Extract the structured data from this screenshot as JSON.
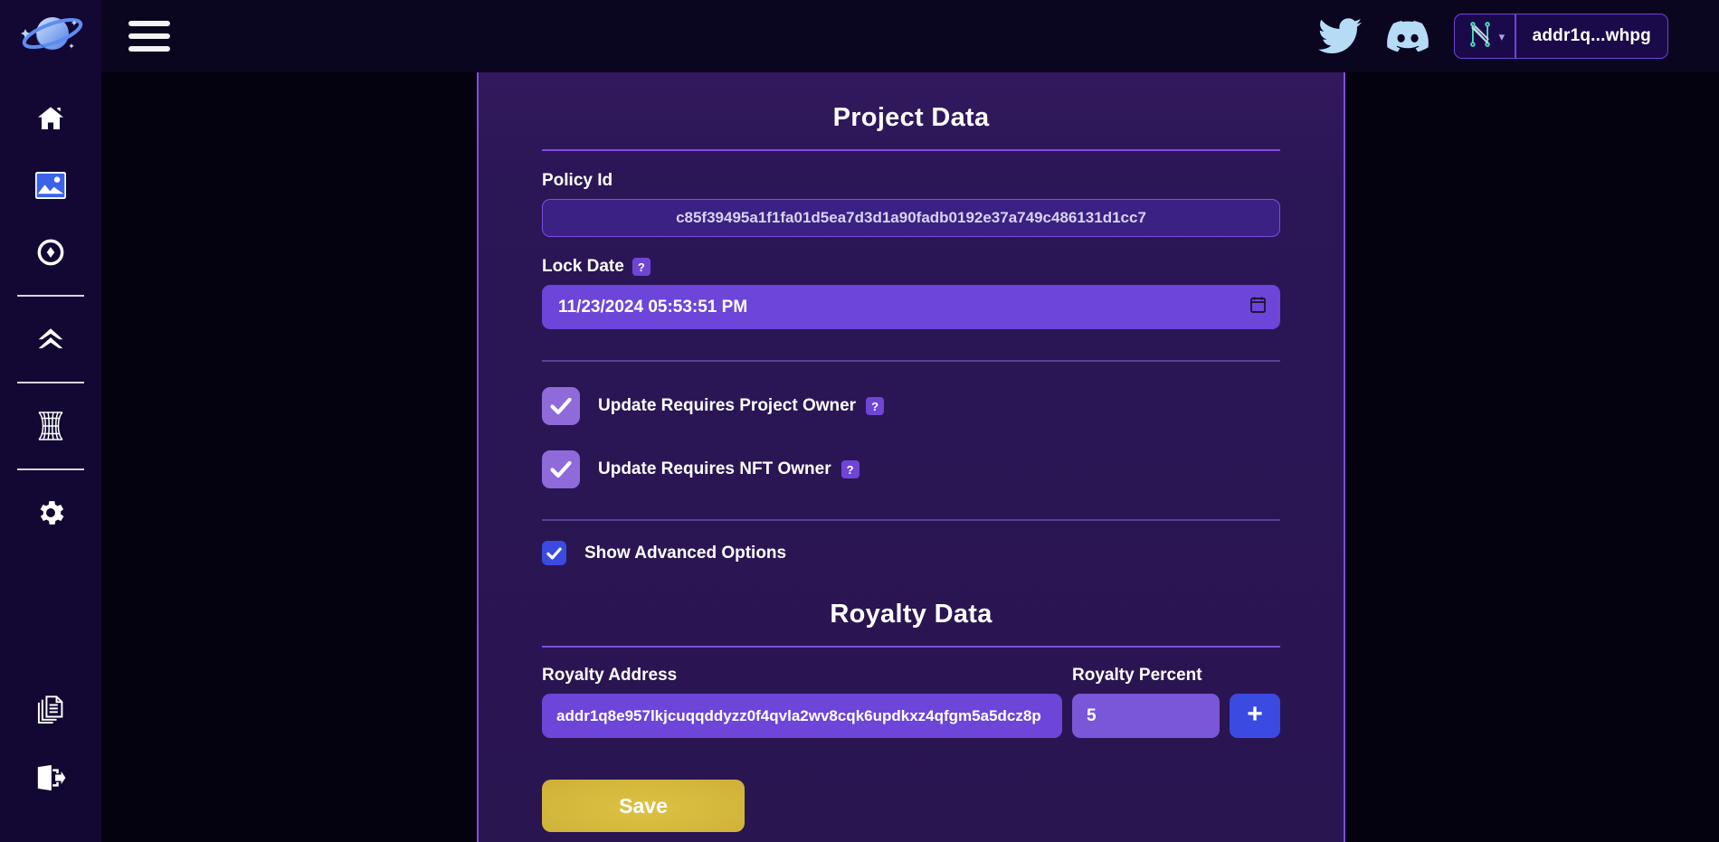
{
  "brand": {
    "logo_icon": "saturn-planet-logo"
  },
  "sidebar": {
    "items": [
      {
        "icon": "home-icon",
        "name": "home"
      },
      {
        "icon": "image-icon",
        "name": "gallery",
        "active": true
      },
      {
        "icon": "compass-eye-icon",
        "name": "explore"
      },
      {
        "icon": "double-chevron-up-icon",
        "name": "upgrade"
      },
      {
        "icon": "wormhole-grid-icon",
        "name": "wormhole"
      },
      {
        "icon": "gear-icon",
        "name": "settings"
      }
    ],
    "bottom_items": [
      {
        "icon": "documents-icon",
        "name": "documents"
      },
      {
        "icon": "sign-out-icon",
        "name": "sign-out"
      }
    ]
  },
  "topbar": {
    "menu_icon": "hamburger-menu-icon",
    "twitter_icon": "twitter-bird-icon",
    "discord_icon": "discord-icon",
    "wallet": {
      "provider_icon": "nami-wallet-icon",
      "caret_icon": "chevron-down-icon",
      "address": "addr1q...whpg"
    }
  },
  "project_data": {
    "title": "Project Data",
    "policy_id": {
      "label": "Policy Id",
      "value": "c85f39495a1f1fa01d5ea7d3d1a90fadb0192e37a749c486131d1cc7"
    },
    "lock_date": {
      "label": "Lock Date",
      "help": "?",
      "value": "11/23/2024 05:53:51 PM",
      "picker_icon": "calendar-icon"
    },
    "checkboxes": [
      {
        "label": "Update Requires Project Owner",
        "help": "?",
        "checked": true,
        "size": "lg"
      },
      {
        "label": "Update Requires NFT Owner",
        "help": "?",
        "checked": true,
        "size": "lg"
      }
    ],
    "advanced": {
      "label": "Show Advanced Options",
      "checked": true
    }
  },
  "royalty_data": {
    "title": "Royalty Data",
    "address": {
      "label": "Royalty Address",
      "value": "addr1q8e957lkjcuqqddyzz0f4qvla2wv8cqk6updkxz4qfgm5a5dcz8p"
    },
    "percent": {
      "label": "Royalty Percent",
      "value": "5"
    },
    "add_button": {
      "icon": "plus-icon",
      "label": "+"
    }
  },
  "actions": {
    "save_label": "Save"
  },
  "colors": {
    "page_bg": "#05020f",
    "sidebar_bg": "#130733",
    "topbar_bg": "#0b0620",
    "card_bg": "#2b1656",
    "accent_purple": "#7b4fe0",
    "input_purple": "#6d45d9",
    "accent_blue": "#3b4ae0",
    "save_gold": "#d4b83c"
  }
}
